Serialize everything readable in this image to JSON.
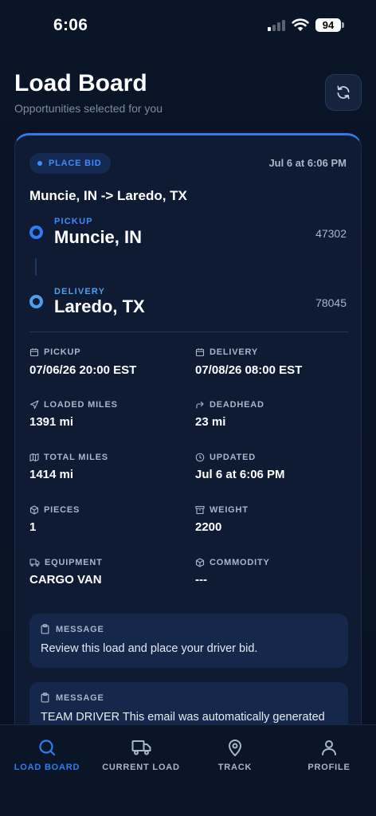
{
  "status_bar": {
    "time": "6:06",
    "battery": "94"
  },
  "header": {
    "title": "Load Board",
    "subtitle": "Opportunities selected for you",
    "refresh_icon": "refresh-icon"
  },
  "load": {
    "badge": "PLACE BID",
    "posted": "Jul 6 at 6:06 PM",
    "route": "Muncie, IN -> Laredo, TX",
    "pickup": {
      "label": "PICKUP",
      "city": "Muncie, IN",
      "zip": "47302"
    },
    "delivery": {
      "label": "DELIVERY",
      "city": "Laredo, TX",
      "zip": "78045"
    },
    "details": {
      "pickup_time": {
        "label": "PICKUP",
        "value": "07/06/26 20:00 EST",
        "icon": "calendar-icon"
      },
      "delivery_time": {
        "label": "DELIVERY",
        "value": "07/08/26 08:00 EST",
        "icon": "calendar-icon"
      },
      "loaded_miles": {
        "label": "LOADED MILES",
        "value": "1391 mi",
        "icon": "navigation-arrow-icon"
      },
      "deadhead": {
        "label": "DEADHEAD",
        "value": "23 mi",
        "icon": "corner-arrow-icon"
      },
      "total_miles": {
        "label": "TOTAL MILES",
        "value": "1414 mi",
        "icon": "map-icon"
      },
      "updated": {
        "label": "UPDATED",
        "value": "Jul 6 at 6:06 PM",
        "icon": "clock-icon"
      },
      "pieces": {
        "label": "PIECES",
        "value": "1",
        "icon": "package-icon"
      },
      "weight": {
        "label": "WEIGHT",
        "value": "2200",
        "icon": "archive-icon"
      },
      "equipment": {
        "label": "EQUIPMENT",
        "value": "CARGO VAN",
        "icon": "truck-icon"
      },
      "commodity": {
        "label": "COMMODITY",
        "value": "---",
        "icon": "box-icon"
      }
    },
    "messages": [
      {
        "label": "MESSAGE",
        "text": "Review this load and place your driver bid."
      },
      {
        "label": "MESSAGE",
        "text": "TEAM DRIVER This email was automatically generated"
      }
    ]
  },
  "nav": [
    {
      "label": "LOAD BOARD",
      "icon": "search-icon",
      "active": true
    },
    {
      "label": "CURRENT LOAD",
      "icon": "truck-icon",
      "active": false
    },
    {
      "label": "TRACK",
      "icon": "map-pin-icon",
      "active": false
    },
    {
      "label": "PROFILE",
      "icon": "user-icon",
      "active": false
    }
  ],
  "colors": {
    "accent": "#2f7bf0",
    "background": "#0a1426",
    "card": "#0e1b33",
    "muted_text": "#a9b6cb"
  }
}
